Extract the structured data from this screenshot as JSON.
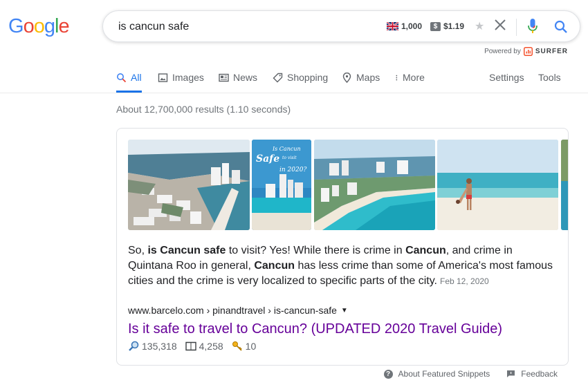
{
  "logo": "Google",
  "search": {
    "query": "is cancun safe",
    "volume": "1,000",
    "cpc": "$1.19",
    "dollar_symbol": "$"
  },
  "powered_by": {
    "label": "Powered by",
    "brand": "SURFER"
  },
  "tabs": [
    {
      "label": "All",
      "icon": "search-icon",
      "active": true
    },
    {
      "label": "Images",
      "icon": "image-icon"
    },
    {
      "label": "News",
      "icon": "newspaper-icon"
    },
    {
      "label": "Shopping",
      "icon": "tag-icon"
    },
    {
      "label": "Maps",
      "icon": "map-pin-icon"
    },
    {
      "label": "More",
      "icon": "more-vert-icon"
    }
  ],
  "tools": {
    "settings": "Settings",
    "tools": "Tools"
  },
  "result_stats": "About 12,700,000 results (1.10 seconds)",
  "featured_snippet": {
    "images": [
      {
        "alt": "Cancun coastline aerial"
      },
      {
        "alt": "Is Cancun Safe to visit in 2020?",
        "overlay": [
          "Is Cancun",
          "Safe",
          "to visit",
          "in 2020?"
        ]
      },
      {
        "alt": "Cancun hotel zone beach"
      },
      {
        "alt": "Couple on Cancun beach"
      }
    ],
    "text_parts": [
      "So, ",
      "is Cancun safe",
      " to visit? Yes! While there is crime in ",
      "Cancun",
      ", and crime in Quintana Roo in general, ",
      "Cancun",
      " has less crime than some of America's most famous cities and the crime is very localized to specific parts of the city."
    ],
    "date": "Feb 12, 2020",
    "breadcrumb": "www.barcelo.com › pinandtravel › is-cancun-safe",
    "title": "Is it safe to travel to Cancun? (UPDATED 2020 Travel Guide)",
    "metrics": {
      "backlinks": "135,318",
      "words": "4,258",
      "keywords": "10"
    }
  },
  "footer": {
    "about": "About Featured Snippets",
    "feedback": "Feedback",
    "help_glyph": "?"
  },
  "colors": {
    "google_blue": "#4285F4",
    "google_red": "#EA4335",
    "google_yellow": "#FBBC05",
    "google_green": "#34A853",
    "link_visited": "#660099",
    "active_tab": "#1a73e8"
  }
}
